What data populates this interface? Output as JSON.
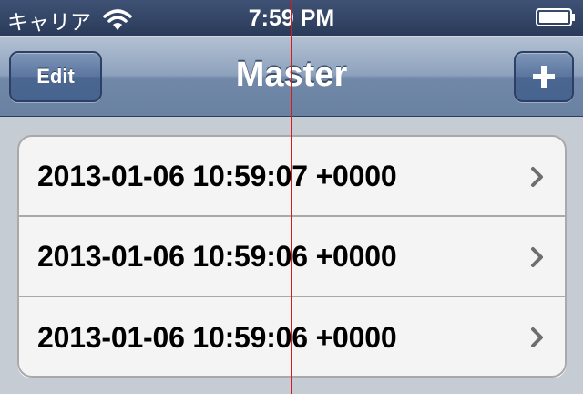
{
  "status_bar": {
    "carrier": "キャリア",
    "time": "7:59 PM"
  },
  "nav_bar": {
    "title": "Master",
    "left_button": "Edit",
    "right_button_icon": "plus-icon"
  },
  "table": {
    "rows": [
      {
        "label": "2013-01-06 10:59:07 +0000"
      },
      {
        "label": "2013-01-06 10:59:06 +0000"
      },
      {
        "label": "2013-01-06 10:59:06 +0000"
      }
    ]
  },
  "colors": {
    "nav_gradient_top": "#b2c0d3",
    "nav_gradient_bottom": "#6a82a2",
    "button_blue": "#4a6691",
    "guide_line": "#d81a1a",
    "cell_background": "#f4f4f4"
  }
}
